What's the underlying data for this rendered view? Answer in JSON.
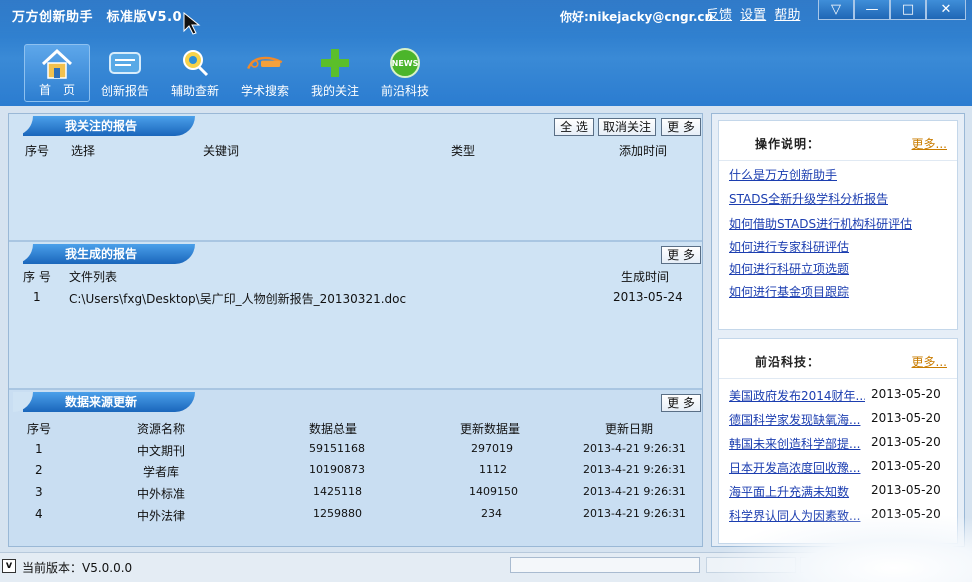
{
  "app": {
    "title": "万方创新助手　标准版V5.0",
    "greeting": "你好:nikejacky@cngr.cn",
    "links": [
      "反馈",
      "设置",
      "帮助"
    ]
  },
  "window_controls": [
    "▽",
    "—",
    "□",
    "✕"
  ],
  "nav": [
    {
      "label": "首　页",
      "icon": "home-icon",
      "active": true
    },
    {
      "label": "创新报告",
      "icon": "report-icon"
    },
    {
      "label": "辅助查新",
      "icon": "search-assist-icon"
    },
    {
      "label": "学术搜索",
      "icon": "science-icon"
    },
    {
      "label": "我的关注",
      "icon": "plus-icon"
    },
    {
      "label": "前沿科技",
      "icon": "news-icon"
    }
  ],
  "followed_reports": {
    "title": "我关注的报告",
    "buttons": {
      "select_all": "全 选",
      "unfollow": "取消关注",
      "more": "更 多"
    },
    "columns": [
      "序号",
      "选择",
      "关键词",
      "类型",
      "添加时间"
    ]
  },
  "generated_reports": {
    "title": "我生成的报告",
    "more": "更 多",
    "columns": [
      "序 号",
      "文件列表",
      "生成时间"
    ],
    "rows": [
      {
        "no": "1",
        "file": "C:\\Users\\fxg\\Desktop\\吴广印_人物创新报告_20130321.doc",
        "time": "2013-05-24"
      }
    ]
  },
  "data_sources": {
    "title": "数据来源更新",
    "more": "更 多",
    "columns": [
      "序号",
      "资源名称",
      "数据总量",
      "更新数据量",
      "更新日期"
    ],
    "rows": [
      {
        "no": "1",
        "name": "中文期刊",
        "total": "59151168",
        "updated": "297019",
        "date": "2013-4-21 9:26:31"
      },
      {
        "no": "2",
        "name": "学者库",
        "total": "10190873",
        "updated": "1112",
        "date": "2013-4-21 9:26:31"
      },
      {
        "no": "3",
        "name": "中外标准",
        "total": "1425118",
        "updated": "1409150",
        "date": "2013-4-21 9:26:31"
      },
      {
        "no": "4",
        "name": "中外法律",
        "total": "1259880",
        "updated": "234",
        "date": "2013-4-21 9:26:31"
      }
    ]
  },
  "instructions": {
    "title": "操作说明：",
    "more": "更多...",
    "links": [
      "什么是万方创新助手",
      "STADS全新升级学科分析报告",
      "如何借助STADS进行机构科研评估",
      "如何进行专家科研评估",
      "如何进行科研立项选题",
      "如何进行基金项目跟踪"
    ]
  },
  "frontier": {
    "title": "前沿科技：",
    "more": "更多...",
    "items": [
      {
        "title": "美国政府发布2014财年...",
        "date": "2013-05-20"
      },
      {
        "title": "德国科学家发现缺氧海...",
        "date": "2013-05-20"
      },
      {
        "title": "韩国未来创造科学部提...",
        "date": "2013-05-20"
      },
      {
        "title": "日本开发高浓度回收豫...",
        "date": "2013-05-20"
      },
      {
        "title": "海平面上升充满未知数",
        "date": "2013-05-20"
      },
      {
        "title": "科学界认同人为因素致...",
        "date": "2013-05-20"
      }
    ]
  },
  "status": {
    "checkbox": "v",
    "version": "当前版本：V5.0.0.0"
  }
}
